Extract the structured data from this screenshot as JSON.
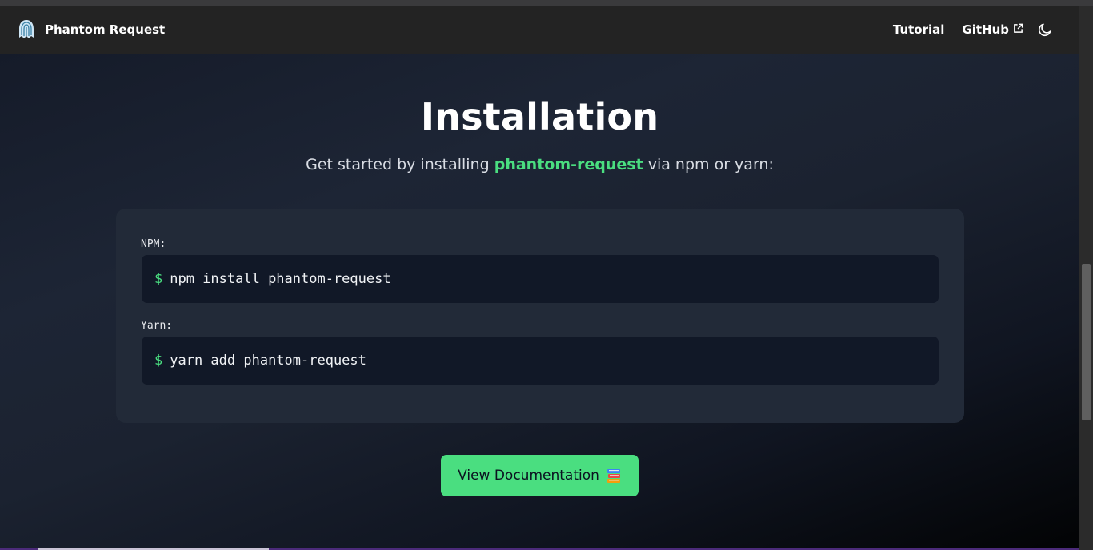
{
  "navbar": {
    "brand_name": "Phantom Request",
    "links": {
      "tutorial": "Tutorial",
      "github": "GitHub"
    },
    "icons": {
      "logo": "ghost-fingerprint-icon",
      "external": "external-link-icon",
      "theme": "moon-icon"
    }
  },
  "hero": {
    "title": "Installation",
    "subtitle_before": "Get started by installing ",
    "subtitle_package": "phantom-request",
    "subtitle_after": " via npm or yarn:"
  },
  "install": {
    "npm": {
      "label": "NPM:",
      "prompt": "$",
      "command": "npm install phantom-request"
    },
    "yarn": {
      "label": "Yarn:",
      "prompt": "$",
      "command": "yarn add phantom-request"
    }
  },
  "docs_button": {
    "label": "View Documentation",
    "icon": "books-icon"
  },
  "colors": {
    "accent": "#4ade80",
    "navbar_bg": "#232323",
    "card_bg": "#222a38",
    "code_bg": "#111827"
  }
}
